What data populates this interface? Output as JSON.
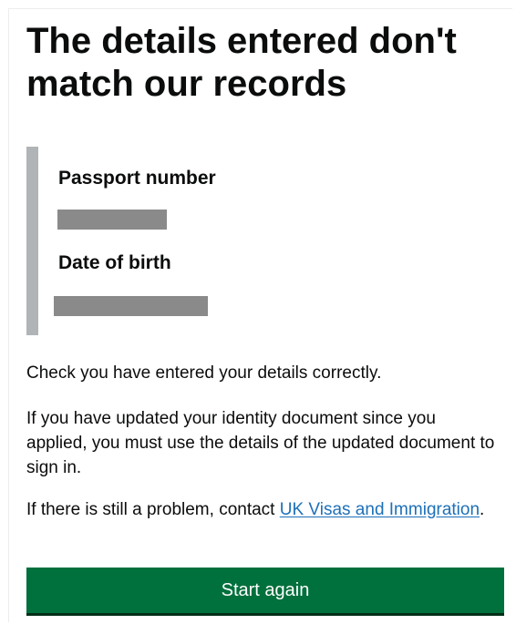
{
  "page": {
    "title": "The details entered don't match our records"
  },
  "details": {
    "passport_label": "Passport number",
    "dob_label": "Date of birth"
  },
  "messages": {
    "check": "Check you have entered your details correctly.",
    "updated": "If you have updated your identity document since you applied, you must use the details of the updated document to sign in.",
    "problem_prefix": "If there is still a problem, contact ",
    "problem_link": "UK Visas and Immigration",
    "problem_suffix": "."
  },
  "actions": {
    "start_again_label": "Start again"
  },
  "colors": {
    "button_green": "#00703c",
    "link_blue": "#1d70b8",
    "inset_border": "#b1b4b6",
    "redaction_gray": "#8a8a8a"
  }
}
